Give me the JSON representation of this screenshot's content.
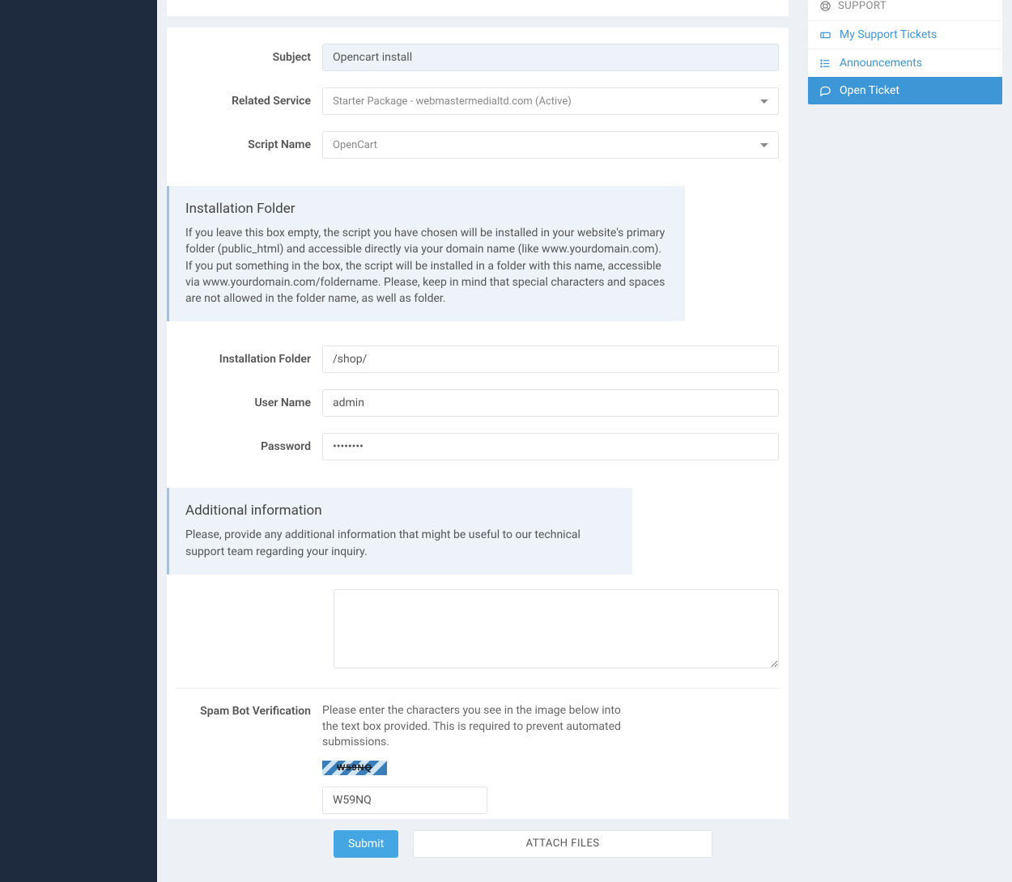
{
  "form": {
    "subject_label": "Subject",
    "subject_value": "Opencart install",
    "related_service_label": "Related Service",
    "related_service_value": "Starter Package - webmastermedialtd.com (Active)",
    "script_name_label": "Script Name",
    "script_name_value": "OpenCart",
    "install_folder_label": "Installation Folder",
    "install_folder_value": "/shop/",
    "username_label": "User Name",
    "username_value": "admin",
    "password_label": "Password",
    "password_value": "••••••••",
    "spam_label": "Spam Bot Verification",
    "spam_help": "Please enter the characters you see in the image below into the text box provided. This is required to prevent automated submissions.",
    "captcha_text": "W59NQ",
    "captcha_value": "W59NQ",
    "submit_label": "Submit",
    "attach_label": "ATTACH FILES"
  },
  "info": {
    "install_title": "Installation Folder",
    "install_text": "If you leave this box empty, the script you have chosen will be installed in your website's primary folder (public_html) and accessible directly via your domain name (like www.yourdomain.com). If you put something in the box, the script will be installed in a folder with this name, accessible via www.yourdomain.com/foldername. Please, keep in mind that special characters and spaces are not allowed in the folder name, as well as folder.",
    "additional_title": "Additional information",
    "additional_text": "Please, provide any additional information that might be useful to our technical support team regarding your inquiry."
  },
  "sidebar": {
    "header": "SUPPORT",
    "items": [
      {
        "label": "My Support Tickets"
      },
      {
        "label": "Announcements"
      },
      {
        "label": "Open Ticket"
      }
    ]
  }
}
